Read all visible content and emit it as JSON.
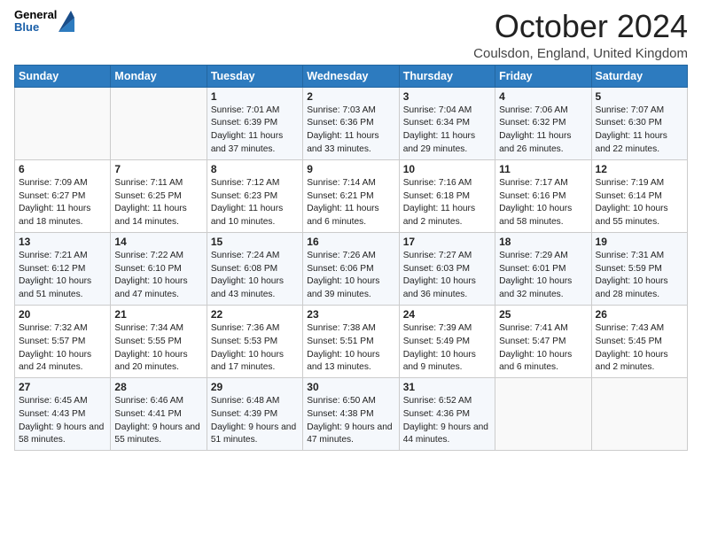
{
  "logo": {
    "general": "General",
    "blue": "Blue"
  },
  "title": "October 2024",
  "subtitle": "Coulsdon, England, United Kingdom",
  "days_of_week": [
    "Sunday",
    "Monday",
    "Tuesday",
    "Wednesday",
    "Thursday",
    "Friday",
    "Saturday"
  ],
  "weeks": [
    [
      {
        "day": "",
        "info": ""
      },
      {
        "day": "",
        "info": ""
      },
      {
        "day": "1",
        "info": "Sunrise: 7:01 AM\nSunset: 6:39 PM\nDaylight: 11 hours and 37 minutes."
      },
      {
        "day": "2",
        "info": "Sunrise: 7:03 AM\nSunset: 6:36 PM\nDaylight: 11 hours and 33 minutes."
      },
      {
        "day": "3",
        "info": "Sunrise: 7:04 AM\nSunset: 6:34 PM\nDaylight: 11 hours and 29 minutes."
      },
      {
        "day": "4",
        "info": "Sunrise: 7:06 AM\nSunset: 6:32 PM\nDaylight: 11 hours and 26 minutes."
      },
      {
        "day": "5",
        "info": "Sunrise: 7:07 AM\nSunset: 6:30 PM\nDaylight: 11 hours and 22 minutes."
      }
    ],
    [
      {
        "day": "6",
        "info": "Sunrise: 7:09 AM\nSunset: 6:27 PM\nDaylight: 11 hours and 18 minutes."
      },
      {
        "day": "7",
        "info": "Sunrise: 7:11 AM\nSunset: 6:25 PM\nDaylight: 11 hours and 14 minutes."
      },
      {
        "day": "8",
        "info": "Sunrise: 7:12 AM\nSunset: 6:23 PM\nDaylight: 11 hours and 10 minutes."
      },
      {
        "day": "9",
        "info": "Sunrise: 7:14 AM\nSunset: 6:21 PM\nDaylight: 11 hours and 6 minutes."
      },
      {
        "day": "10",
        "info": "Sunrise: 7:16 AM\nSunset: 6:18 PM\nDaylight: 11 hours and 2 minutes."
      },
      {
        "day": "11",
        "info": "Sunrise: 7:17 AM\nSunset: 6:16 PM\nDaylight: 10 hours and 58 minutes."
      },
      {
        "day": "12",
        "info": "Sunrise: 7:19 AM\nSunset: 6:14 PM\nDaylight: 10 hours and 55 minutes."
      }
    ],
    [
      {
        "day": "13",
        "info": "Sunrise: 7:21 AM\nSunset: 6:12 PM\nDaylight: 10 hours and 51 minutes."
      },
      {
        "day": "14",
        "info": "Sunrise: 7:22 AM\nSunset: 6:10 PM\nDaylight: 10 hours and 47 minutes."
      },
      {
        "day": "15",
        "info": "Sunrise: 7:24 AM\nSunset: 6:08 PM\nDaylight: 10 hours and 43 minutes."
      },
      {
        "day": "16",
        "info": "Sunrise: 7:26 AM\nSunset: 6:06 PM\nDaylight: 10 hours and 39 minutes."
      },
      {
        "day": "17",
        "info": "Sunrise: 7:27 AM\nSunset: 6:03 PM\nDaylight: 10 hours and 36 minutes."
      },
      {
        "day": "18",
        "info": "Sunrise: 7:29 AM\nSunset: 6:01 PM\nDaylight: 10 hours and 32 minutes."
      },
      {
        "day": "19",
        "info": "Sunrise: 7:31 AM\nSunset: 5:59 PM\nDaylight: 10 hours and 28 minutes."
      }
    ],
    [
      {
        "day": "20",
        "info": "Sunrise: 7:32 AM\nSunset: 5:57 PM\nDaylight: 10 hours and 24 minutes."
      },
      {
        "day": "21",
        "info": "Sunrise: 7:34 AM\nSunset: 5:55 PM\nDaylight: 10 hours and 20 minutes."
      },
      {
        "day": "22",
        "info": "Sunrise: 7:36 AM\nSunset: 5:53 PM\nDaylight: 10 hours and 17 minutes."
      },
      {
        "day": "23",
        "info": "Sunrise: 7:38 AM\nSunset: 5:51 PM\nDaylight: 10 hours and 13 minutes."
      },
      {
        "day": "24",
        "info": "Sunrise: 7:39 AM\nSunset: 5:49 PM\nDaylight: 10 hours and 9 minutes."
      },
      {
        "day": "25",
        "info": "Sunrise: 7:41 AM\nSunset: 5:47 PM\nDaylight: 10 hours and 6 minutes."
      },
      {
        "day": "26",
        "info": "Sunrise: 7:43 AM\nSunset: 5:45 PM\nDaylight: 10 hours and 2 minutes."
      }
    ],
    [
      {
        "day": "27",
        "info": "Sunrise: 6:45 AM\nSunset: 4:43 PM\nDaylight: 9 hours and 58 minutes."
      },
      {
        "day": "28",
        "info": "Sunrise: 6:46 AM\nSunset: 4:41 PM\nDaylight: 9 hours and 55 minutes."
      },
      {
        "day": "29",
        "info": "Sunrise: 6:48 AM\nSunset: 4:39 PM\nDaylight: 9 hours and 51 minutes."
      },
      {
        "day": "30",
        "info": "Sunrise: 6:50 AM\nSunset: 4:38 PM\nDaylight: 9 hours and 47 minutes."
      },
      {
        "day": "31",
        "info": "Sunrise: 6:52 AM\nSunset: 4:36 PM\nDaylight: 9 hours and 44 minutes."
      },
      {
        "day": "",
        "info": ""
      },
      {
        "day": "",
        "info": ""
      }
    ]
  ]
}
